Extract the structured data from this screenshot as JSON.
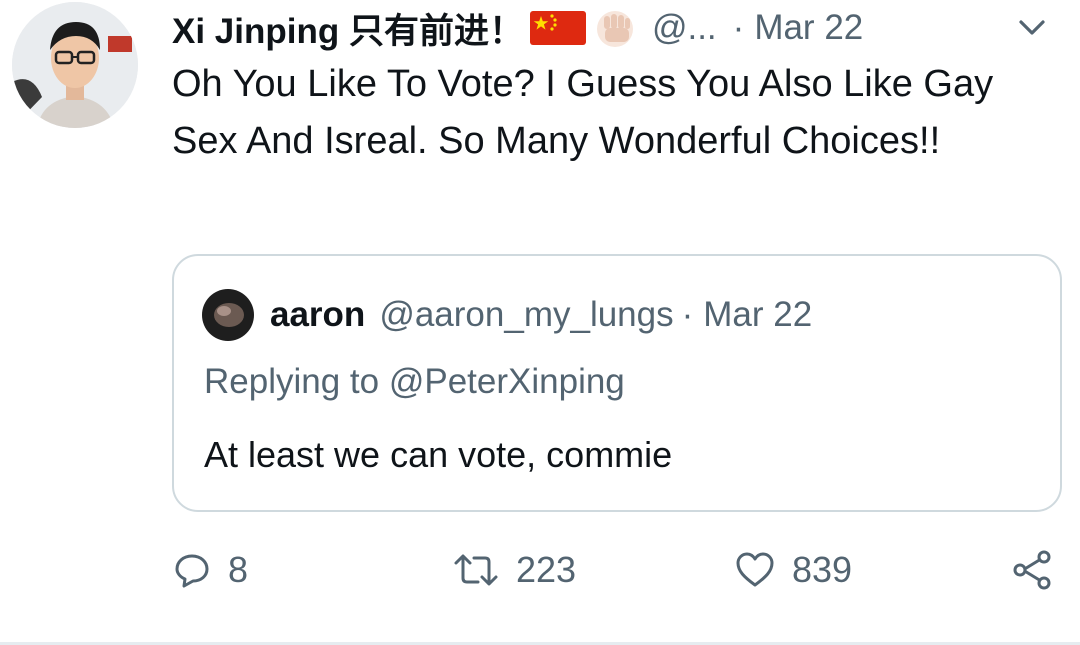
{
  "tweet": {
    "author_name": "Xi Jinping 只有前进！",
    "author_handle": "@...",
    "separator": "·",
    "date": "Mar 22",
    "text": "Oh You Like To Vote? I Guess You Also Like Gay Sex And Isreal. So Many Wonderful Choices!!",
    "icons": {
      "flag": "china-flag-icon",
      "emoji": "raised-fist-icon",
      "menu": "chevron-down-icon"
    }
  },
  "quote": {
    "author_name": "aaron",
    "author_handle": "@aaron_my_lungs",
    "separator": "·",
    "date": "Mar 22",
    "replying_to": "Replying to @PeterXinping",
    "text": "At least we can vote, commie"
  },
  "actions": {
    "reply_count": "8",
    "retweet_count": "223",
    "like_count": "839"
  },
  "colors": {
    "text": "#0f1419",
    "muted": "#536471",
    "border": "#cfd9de",
    "flag_red": "#de2910",
    "flag_star": "#ffde00"
  }
}
